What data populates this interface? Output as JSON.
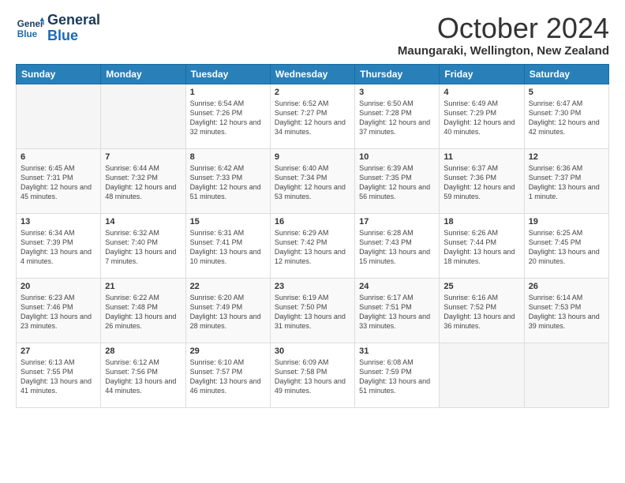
{
  "header": {
    "logo_line1": "General",
    "logo_line2": "Blue",
    "month_title": "October 2024",
    "location": "Maungaraki, Wellington, New Zealand"
  },
  "days_of_week": [
    "Sunday",
    "Monday",
    "Tuesday",
    "Wednesday",
    "Thursday",
    "Friday",
    "Saturday"
  ],
  "weeks": [
    [
      {
        "num": "",
        "info": ""
      },
      {
        "num": "",
        "info": ""
      },
      {
        "num": "1",
        "info": "Sunrise: 6:54 AM\nSunset: 7:26 PM\nDaylight: 12 hours and 32 minutes."
      },
      {
        "num": "2",
        "info": "Sunrise: 6:52 AM\nSunset: 7:27 PM\nDaylight: 12 hours and 34 minutes."
      },
      {
        "num": "3",
        "info": "Sunrise: 6:50 AM\nSunset: 7:28 PM\nDaylight: 12 hours and 37 minutes."
      },
      {
        "num": "4",
        "info": "Sunrise: 6:49 AM\nSunset: 7:29 PM\nDaylight: 12 hours and 40 minutes."
      },
      {
        "num": "5",
        "info": "Sunrise: 6:47 AM\nSunset: 7:30 PM\nDaylight: 12 hours and 42 minutes."
      }
    ],
    [
      {
        "num": "6",
        "info": "Sunrise: 6:45 AM\nSunset: 7:31 PM\nDaylight: 12 hours and 45 minutes."
      },
      {
        "num": "7",
        "info": "Sunrise: 6:44 AM\nSunset: 7:32 PM\nDaylight: 12 hours and 48 minutes."
      },
      {
        "num": "8",
        "info": "Sunrise: 6:42 AM\nSunset: 7:33 PM\nDaylight: 12 hours and 51 minutes."
      },
      {
        "num": "9",
        "info": "Sunrise: 6:40 AM\nSunset: 7:34 PM\nDaylight: 12 hours and 53 minutes."
      },
      {
        "num": "10",
        "info": "Sunrise: 6:39 AM\nSunset: 7:35 PM\nDaylight: 12 hours and 56 minutes."
      },
      {
        "num": "11",
        "info": "Sunrise: 6:37 AM\nSunset: 7:36 PM\nDaylight: 12 hours and 59 minutes."
      },
      {
        "num": "12",
        "info": "Sunrise: 6:36 AM\nSunset: 7:37 PM\nDaylight: 13 hours and 1 minute."
      }
    ],
    [
      {
        "num": "13",
        "info": "Sunrise: 6:34 AM\nSunset: 7:39 PM\nDaylight: 13 hours and 4 minutes."
      },
      {
        "num": "14",
        "info": "Sunrise: 6:32 AM\nSunset: 7:40 PM\nDaylight: 13 hours and 7 minutes."
      },
      {
        "num": "15",
        "info": "Sunrise: 6:31 AM\nSunset: 7:41 PM\nDaylight: 13 hours and 10 minutes."
      },
      {
        "num": "16",
        "info": "Sunrise: 6:29 AM\nSunset: 7:42 PM\nDaylight: 13 hours and 12 minutes."
      },
      {
        "num": "17",
        "info": "Sunrise: 6:28 AM\nSunset: 7:43 PM\nDaylight: 13 hours and 15 minutes."
      },
      {
        "num": "18",
        "info": "Sunrise: 6:26 AM\nSunset: 7:44 PM\nDaylight: 13 hours and 18 minutes."
      },
      {
        "num": "19",
        "info": "Sunrise: 6:25 AM\nSunset: 7:45 PM\nDaylight: 13 hours and 20 minutes."
      }
    ],
    [
      {
        "num": "20",
        "info": "Sunrise: 6:23 AM\nSunset: 7:46 PM\nDaylight: 13 hours and 23 minutes."
      },
      {
        "num": "21",
        "info": "Sunrise: 6:22 AM\nSunset: 7:48 PM\nDaylight: 13 hours and 26 minutes."
      },
      {
        "num": "22",
        "info": "Sunrise: 6:20 AM\nSunset: 7:49 PM\nDaylight: 13 hours and 28 minutes."
      },
      {
        "num": "23",
        "info": "Sunrise: 6:19 AM\nSunset: 7:50 PM\nDaylight: 13 hours and 31 minutes."
      },
      {
        "num": "24",
        "info": "Sunrise: 6:17 AM\nSunset: 7:51 PM\nDaylight: 13 hours and 33 minutes."
      },
      {
        "num": "25",
        "info": "Sunrise: 6:16 AM\nSunset: 7:52 PM\nDaylight: 13 hours and 36 minutes."
      },
      {
        "num": "26",
        "info": "Sunrise: 6:14 AM\nSunset: 7:53 PM\nDaylight: 13 hours and 39 minutes."
      }
    ],
    [
      {
        "num": "27",
        "info": "Sunrise: 6:13 AM\nSunset: 7:55 PM\nDaylight: 13 hours and 41 minutes."
      },
      {
        "num": "28",
        "info": "Sunrise: 6:12 AM\nSunset: 7:56 PM\nDaylight: 13 hours and 44 minutes."
      },
      {
        "num": "29",
        "info": "Sunrise: 6:10 AM\nSunset: 7:57 PM\nDaylight: 13 hours and 46 minutes."
      },
      {
        "num": "30",
        "info": "Sunrise: 6:09 AM\nSunset: 7:58 PM\nDaylight: 13 hours and 49 minutes."
      },
      {
        "num": "31",
        "info": "Sunrise: 6:08 AM\nSunset: 7:59 PM\nDaylight: 13 hours and 51 minutes."
      },
      {
        "num": "",
        "info": ""
      },
      {
        "num": "",
        "info": ""
      }
    ]
  ]
}
